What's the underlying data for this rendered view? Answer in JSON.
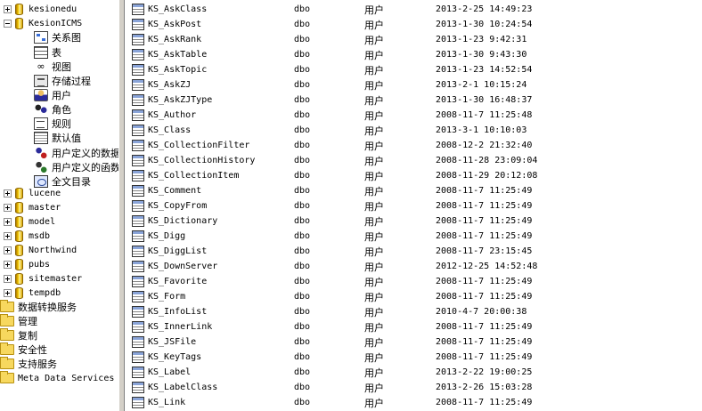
{
  "tree": {
    "nodes": [
      {
        "label": "kesionedu",
        "kind": "db",
        "expander": "plus"
      },
      {
        "label": "KesionICMS",
        "kind": "db",
        "expander": "minus"
      },
      {
        "label": "关系图",
        "kind": "diagram",
        "icon": "diagram-icon"
      },
      {
        "label": "表",
        "kind": "table",
        "icon": "table-icon"
      },
      {
        "label": "视图",
        "kind": "view",
        "icon": "view-icon"
      },
      {
        "label": "存储过程",
        "kind": "proc",
        "icon": "stored-procedure-icon"
      },
      {
        "label": "用户",
        "kind": "user",
        "icon": "user-icon"
      },
      {
        "label": "角色",
        "kind": "role",
        "icon": "role-icon"
      },
      {
        "label": "规则",
        "kind": "rule",
        "icon": "rule-icon"
      },
      {
        "label": "默认值",
        "kind": "default",
        "icon": "default-icon"
      },
      {
        "label": "用户定义的数据",
        "kind": "udt",
        "icon": "user-defined-type-icon"
      },
      {
        "label": "用户定义的函数",
        "kind": "udf",
        "icon": "user-defined-function-icon"
      },
      {
        "label": "全文目录",
        "kind": "fulltext",
        "icon": "fulltext-catalog-icon"
      },
      {
        "label": "lucene",
        "kind": "db",
        "expander": "plus"
      },
      {
        "label": "master",
        "kind": "db",
        "expander": "plus"
      },
      {
        "label": "model",
        "kind": "db",
        "expander": "plus"
      },
      {
        "label": "msdb",
        "kind": "db",
        "expander": "plus"
      },
      {
        "label": "Northwind",
        "kind": "db",
        "expander": "plus"
      },
      {
        "label": "pubs",
        "kind": "db",
        "expander": "plus"
      },
      {
        "label": "sitemaster",
        "kind": "db",
        "expander": "plus"
      },
      {
        "label": "tempdb",
        "kind": "db",
        "expander": "plus"
      },
      {
        "label": "数据转换服务",
        "kind": "folder",
        "icon": "folder-icon"
      },
      {
        "label": "管理",
        "kind": "folder",
        "icon": "folder-icon"
      },
      {
        "label": "复制",
        "kind": "folder",
        "icon": "folder-icon"
      },
      {
        "label": "安全性",
        "kind": "folder",
        "icon": "folder-icon"
      },
      {
        "label": "支持服务",
        "kind": "folder",
        "icon": "folder-icon"
      },
      {
        "label": "Meta Data Services",
        "kind": "folder",
        "icon": "folder-icon"
      }
    ]
  },
  "list": {
    "rows": [
      {
        "name": "KS_AskClass",
        "owner": "dbo",
        "type": "用户",
        "created": "2013-2-25 14:49:23"
      },
      {
        "name": "KS_AskPost",
        "owner": "dbo",
        "type": "用户",
        "created": "2013-1-30 10:24:54"
      },
      {
        "name": "KS_AskRank",
        "owner": "dbo",
        "type": "用户",
        "created": "2013-1-23 9:42:31"
      },
      {
        "name": "KS_AskTable",
        "owner": "dbo",
        "type": "用户",
        "created": "2013-1-30 9:43:30"
      },
      {
        "name": "KS_AskTopic",
        "owner": "dbo",
        "type": "用户",
        "created": "2013-1-23 14:52:54"
      },
      {
        "name": "KS_AskZJ",
        "owner": "dbo",
        "type": "用户",
        "created": "2013-2-1 10:15:24"
      },
      {
        "name": "KS_AskZJType",
        "owner": "dbo",
        "type": "用户",
        "created": "2013-1-30 16:48:37"
      },
      {
        "name": "KS_Author",
        "owner": "dbo",
        "type": "用户",
        "created": "2008-11-7 11:25:48"
      },
      {
        "name": "KS_Class",
        "owner": "dbo",
        "type": "用户",
        "created": "2013-3-1 10:10:03"
      },
      {
        "name": "KS_CollectionFilter",
        "owner": "dbo",
        "type": "用户",
        "created": "2008-12-2 21:32:40"
      },
      {
        "name": "KS_CollectionHistory",
        "owner": "dbo",
        "type": "用户",
        "created": "2008-11-28 23:09:04"
      },
      {
        "name": "KS_CollectionItem",
        "owner": "dbo",
        "type": "用户",
        "created": "2008-11-29 20:12:08"
      },
      {
        "name": "KS_Comment",
        "owner": "dbo",
        "type": "用户",
        "created": "2008-11-7 11:25:49"
      },
      {
        "name": "KS_CopyFrom",
        "owner": "dbo",
        "type": "用户",
        "created": "2008-11-7 11:25:49"
      },
      {
        "name": "KS_Dictionary",
        "owner": "dbo",
        "type": "用户",
        "created": "2008-11-7 11:25:49"
      },
      {
        "name": "KS_Digg",
        "owner": "dbo",
        "type": "用户",
        "created": "2008-11-7 11:25:49"
      },
      {
        "name": "KS_DiggList",
        "owner": "dbo",
        "type": "用户",
        "created": "2008-11-7 23:15:45"
      },
      {
        "name": "KS_DownServer",
        "owner": "dbo",
        "type": "用户",
        "created": "2012-12-25 14:52:48"
      },
      {
        "name": "KS_Favorite",
        "owner": "dbo",
        "type": "用户",
        "created": "2008-11-7 11:25:49"
      },
      {
        "name": "KS_Form",
        "owner": "dbo",
        "type": "用户",
        "created": "2008-11-7 11:25:49"
      },
      {
        "name": "KS_InfoList",
        "owner": "dbo",
        "type": "用户",
        "created": "2010-4-7 20:00:38"
      },
      {
        "name": "KS_InnerLink",
        "owner": "dbo",
        "type": "用户",
        "created": "2008-11-7 11:25:49"
      },
      {
        "name": "KS_JSFile",
        "owner": "dbo",
        "type": "用户",
        "created": "2008-11-7 11:25:49"
      },
      {
        "name": "KS_KeyTags",
        "owner": "dbo",
        "type": "用户",
        "created": "2008-11-7 11:25:49"
      },
      {
        "name": "KS_Label",
        "owner": "dbo",
        "type": "用户",
        "created": "2013-2-22 19:00:25"
      },
      {
        "name": "KS_LabelClass",
        "owner": "dbo",
        "type": "用户",
        "created": "2013-2-26 15:03:28"
      },
      {
        "name": "KS_Link",
        "owner": "dbo",
        "type": "用户",
        "created": "2008-11-7 11:25:49"
      }
    ]
  }
}
